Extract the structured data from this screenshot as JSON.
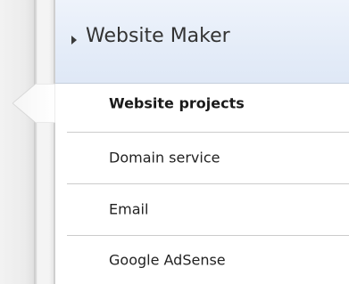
{
  "section": {
    "title": "Website Maker"
  },
  "menu": {
    "items": [
      {
        "label": "Website projects",
        "active": true
      },
      {
        "label": "Domain service",
        "active": false
      },
      {
        "label": "Email",
        "active": false
      },
      {
        "label": "Google AdSense",
        "active": false
      }
    ]
  },
  "colors": {
    "header_bg": "#e4ecf8",
    "text": "#222222",
    "divider": "#cccccc"
  },
  "icons": {
    "header": "caret-right-icon",
    "active_marker": "active-pointer-icon"
  }
}
